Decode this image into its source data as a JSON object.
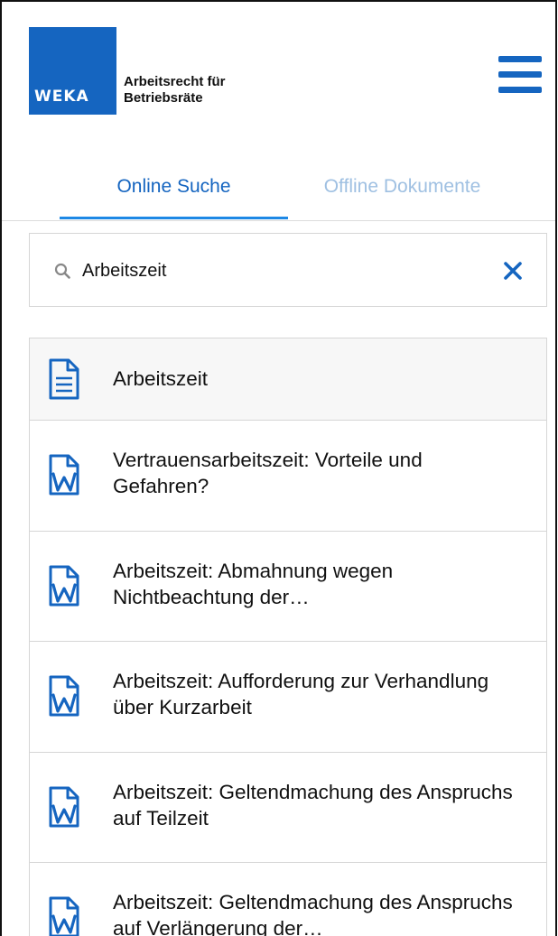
{
  "brand": {
    "logo_text": "WEKA",
    "product_name": "Arbeitsrecht für Betriebsräte",
    "color": "#1565c0"
  },
  "tabs": [
    {
      "label": "Online Suche",
      "active": true
    },
    {
      "label": "Offline Dokumente",
      "active": false
    }
  ],
  "search": {
    "value": "Arbeitszeit",
    "placeholder": ""
  },
  "results": [
    {
      "title": "Arbeitszeit",
      "icon": "document-icon"
    },
    {
      "title": "Vertrauensarbeitszeit: Vorteile und Gefahren?",
      "icon": "word-document-icon"
    },
    {
      "title": "Arbeitszeit: Abmahnung wegen Nichtbeachtung der…",
      "icon": "word-document-icon"
    },
    {
      "title": "Arbeitszeit: Aufforderung zur Verhandlung über Kurzarbeit",
      "icon": "word-document-icon"
    },
    {
      "title": "Arbeitszeit: Geltendmachung des Anspruchs auf Teilzeit",
      "icon": "word-document-icon"
    },
    {
      "title": "Arbeitszeit: Geltendmachung des Anspruchs auf Verlängerung der…",
      "icon": "word-document-icon"
    }
  ]
}
